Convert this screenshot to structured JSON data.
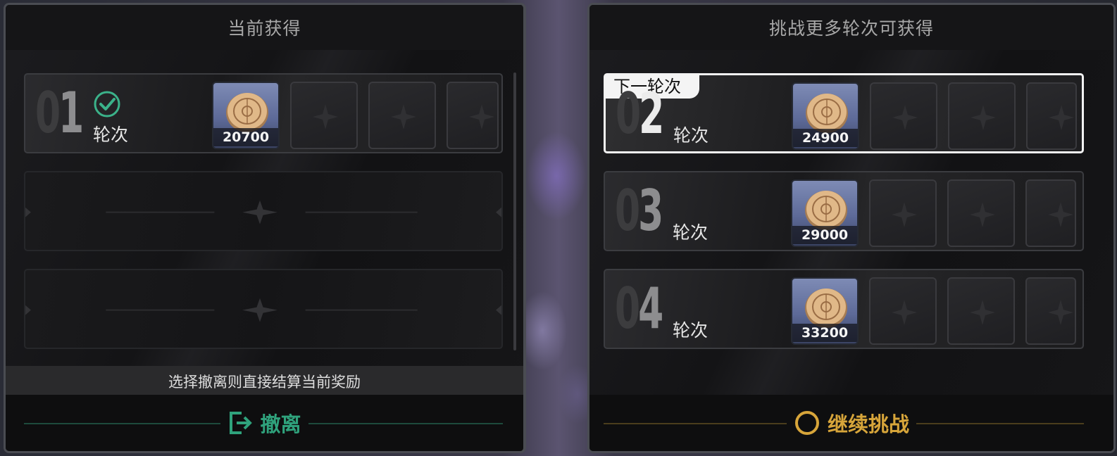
{
  "left_panel": {
    "title": "当前获得",
    "rounds": [
      {
        "number": "01",
        "label": "轮次",
        "completed": true,
        "reward": "20700"
      }
    ],
    "hint": "选择撤离则直接结算当前奖励",
    "action_label": "撤离",
    "action_color": "#2fa27c"
  },
  "right_panel": {
    "title": "挑战更多轮次可获得",
    "next_tag": "下一轮次",
    "rounds": [
      {
        "number": "02",
        "label": "轮次",
        "reward": "24900"
      },
      {
        "number": "03",
        "label": "轮次",
        "reward": "29000"
      },
      {
        "number": "04",
        "label": "轮次",
        "reward": "33200"
      }
    ],
    "action_label": "继续挑战",
    "action_color": "#d7a53a"
  },
  "icons": {
    "reward": "gold-coin-icon",
    "locked_slot": "diamond-star-icon",
    "completed": "check-circle-icon",
    "evacuate": "exit-icon",
    "continue": "ring-icon"
  }
}
